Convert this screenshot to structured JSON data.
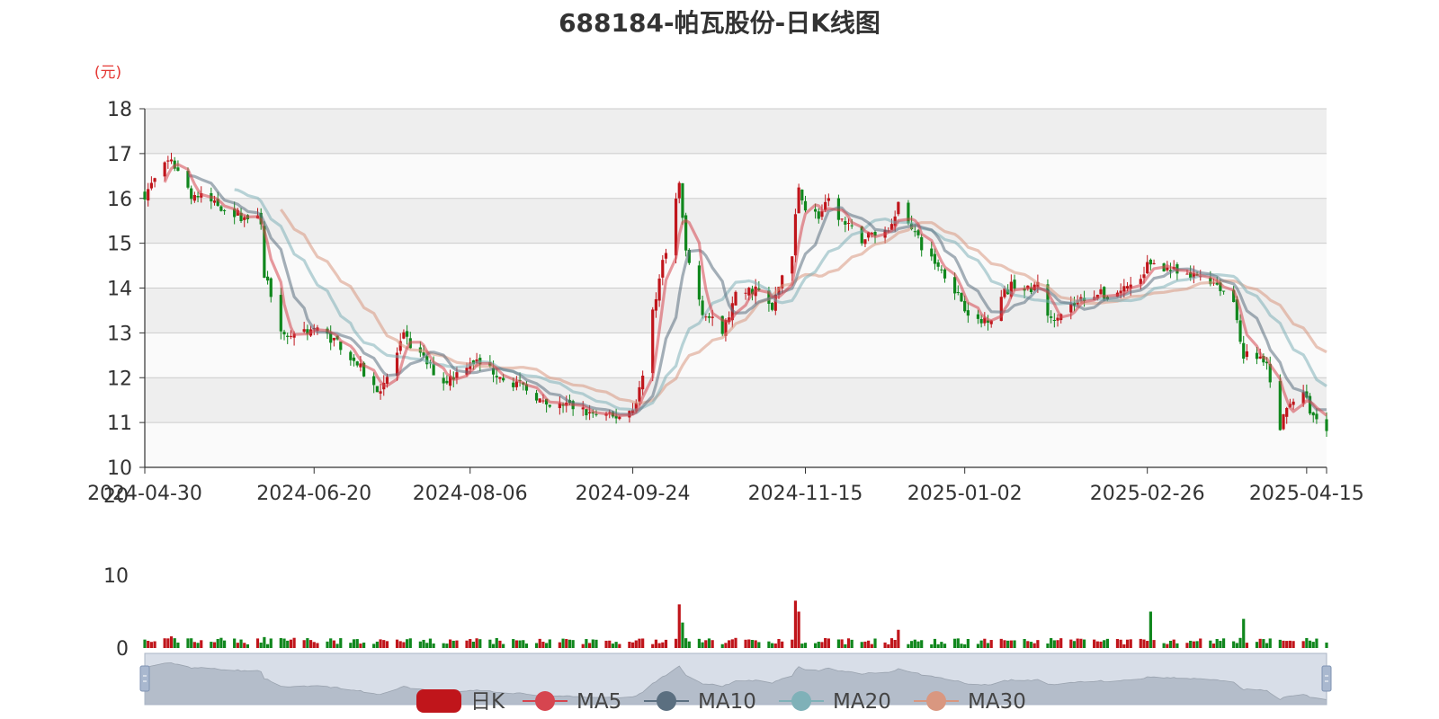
{
  "page": {
    "title": "688184-帕瓦股份-日K线图",
    "unit": "(元)"
  },
  "colors": {
    "up": "#c0151b",
    "down": "#10871d",
    "ma5": "#d6454f",
    "ma10": "#5b6f80",
    "ma20": "#7fb1b8",
    "ma30": "#d99780",
    "band": "#eeeeee",
    "grid": "#cccccc",
    "slider_bg": "#d8dee8",
    "slider_fill": "#b4bdca"
  },
  "legend": [
    {
      "key": "kline",
      "label": "日K",
      "icon": "rounded-rect-icon"
    },
    {
      "key": "ma5",
      "label": "MA5",
      "icon": "line-circle-icon"
    },
    {
      "key": "ma10",
      "label": "MA10",
      "icon": "line-circle-icon"
    },
    {
      "key": "ma20",
      "label": "MA20",
      "icon": "line-circle-icon"
    },
    {
      "key": "ma30",
      "label": "MA30",
      "icon": "line-circle-icon"
    }
  ],
  "chart_data": {
    "type": "candlestick",
    "title": "688184-帕瓦股份-日K线图",
    "ylabel": "(元)",
    "price_axis": {
      "min": 10,
      "max": 18,
      "ticks": [
        10,
        11,
        12,
        13,
        14,
        15,
        16,
        17,
        18
      ]
    },
    "volume_axis": {
      "min": 0,
      "max": 20,
      "ticks": [
        0,
        10,
        20
      ]
    },
    "x_axis": {
      "start": "2024-04-30",
      "end": "2025-04-21",
      "tick_labels": [
        "2024-04-30",
        "2024-06-20",
        "2024-08-06",
        "2024-09-24",
        "2024-11-15",
        "2025-01-02",
        "2025-02-26",
        "2025-04-15"
      ]
    },
    "grid": true,
    "legend_position": "bottom",
    "close_path_waypoints": [
      [
        "2024-04-30",
        16.1
      ],
      [
        "2024-05-03",
        16.4
      ],
      [
        "2024-05-08",
        16.9
      ],
      [
        "2024-05-10",
        16.6
      ],
      [
        "2024-05-14",
        16.1
      ],
      [
        "2024-05-21",
        15.9
      ],
      [
        "2024-05-29",
        15.6
      ],
      [
        "2024-06-04",
        15.5
      ],
      [
        "2024-06-05",
        14.3
      ],
      [
        "2024-06-07",
        13.9
      ],
      [
        "2024-06-11",
        12.9
      ],
      [
        "2024-06-14",
        13.0
      ],
      [
        "2024-06-20",
        13.1
      ],
      [
        "2024-06-27",
        12.8
      ],
      [
        "2024-07-03",
        12.3
      ],
      [
        "2024-07-09",
        11.7
      ],
      [
        "2024-07-12",
        12.0
      ],
      [
        "2024-07-17",
        12.9
      ],
      [
        "2024-07-23",
        12.4
      ],
      [
        "2024-07-29",
        11.9
      ],
      [
        "2024-08-02",
        12.1
      ],
      [
        "2024-08-06",
        12.4
      ],
      [
        "2024-08-12",
        12.2
      ],
      [
        "2024-08-19",
        11.9
      ],
      [
        "2024-08-26",
        11.6
      ],
      [
        "2024-08-29",
        11.3
      ],
      [
        "2024-09-04",
        11.4
      ],
      [
        "2024-09-11",
        11.2
      ],
      [
        "2024-09-18",
        11.1
      ],
      [
        "2024-09-24",
        11.3
      ],
      [
        "2024-09-27",
        12.0
      ],
      [
        "2024-09-30",
        13.5
      ],
      [
        "2024-10-08",
        16.3
      ],
      [
        "2024-10-10",
        14.8
      ],
      [
        "2024-10-15",
        13.5
      ],
      [
        "2024-10-21",
        13.0
      ],
      [
        "2024-10-25",
        13.8
      ],
      [
        "2024-10-31",
        14.0
      ],
      [
        "2024-11-05",
        13.5
      ],
      [
        "2024-11-08",
        14.3
      ],
      [
        "2024-11-11",
        14.8
      ],
      [
        "2024-11-13",
        16.3
      ],
      [
        "2024-11-15",
        15.8
      ],
      [
        "2024-11-19",
        15.6
      ],
      [
        "2024-11-22",
        15.9
      ],
      [
        "2024-11-27",
        15.4
      ],
      [
        "2024-12-02",
        15.1
      ],
      [
        "2024-12-05",
        15.2
      ],
      [
        "2024-12-10",
        15.3
      ],
      [
        "2024-12-13",
        15.9
      ],
      [
        "2024-12-17",
        15.4
      ],
      [
        "2024-12-20",
        14.9
      ],
      [
        "2024-12-25",
        14.5
      ],
      [
        "2024-12-30",
        14.0
      ],
      [
        "2025-01-02",
        13.6
      ],
      [
        "2025-01-06",
        13.2
      ],
      [
        "2025-01-10",
        13.4
      ],
      [
        "2025-01-14",
        13.9
      ],
      [
        "2025-01-17",
        14.1
      ],
      [
        "2025-01-22",
        13.9
      ],
      [
        "2025-01-24",
        14.2
      ],
      [
        "2025-01-27",
        13.3
      ],
      [
        "2025-02-05",
        13.7
      ],
      [
        "2025-02-10",
        13.9
      ],
      [
        "2025-02-14",
        13.8
      ],
      [
        "2025-02-19",
        14.0
      ],
      [
        "2025-02-24",
        14.2
      ],
      [
        "2025-02-26",
        14.5
      ],
      [
        "2025-02-28",
        14.6
      ],
      [
        "2025-03-05",
        14.4
      ],
      [
        "2025-03-10",
        14.2
      ],
      [
        "2025-03-14",
        14.3
      ],
      [
        "2025-03-19",
        14.1
      ],
      [
        "2025-03-24",
        13.7
      ],
      [
        "2025-03-27",
        12.5
      ],
      [
        "2025-04-01",
        12.4
      ],
      [
        "2025-04-03",
        12.2
      ],
      [
        "2025-04-07",
        10.9
      ],
      [
        "2025-04-10",
        11.5
      ],
      [
        "2025-04-14",
        11.6
      ],
      [
        "2025-04-16",
        11.3
      ],
      [
        "2025-04-18",
        11.0
      ],
      [
        "2025-04-21",
        10.9
      ]
    ],
    "candle_notes": "Daily OHLC candles follow the close path; red = close above open, green = close below open.",
    "volume_spikes": [
      [
        "2024-05-08",
        1.6
      ],
      [
        "2024-06-05",
        1.5
      ],
      [
        "2024-10-08",
        6.0
      ],
      [
        "2024-10-09",
        3.5
      ],
      [
        "2024-11-12",
        6.5
      ],
      [
        "2024-11-13",
        5.0
      ],
      [
        "2024-12-13",
        2.5
      ],
      [
        "2025-02-27",
        5.0
      ],
      [
        "2025-03-27",
        4.0
      ]
    ],
    "series": [
      {
        "name": "日K"
      },
      {
        "name": "MA5",
        "window": 5
      },
      {
        "name": "MA10",
        "window": 10
      },
      {
        "name": "MA20",
        "window": 20
      },
      {
        "name": "MA30",
        "window": 30
      }
    ]
  }
}
